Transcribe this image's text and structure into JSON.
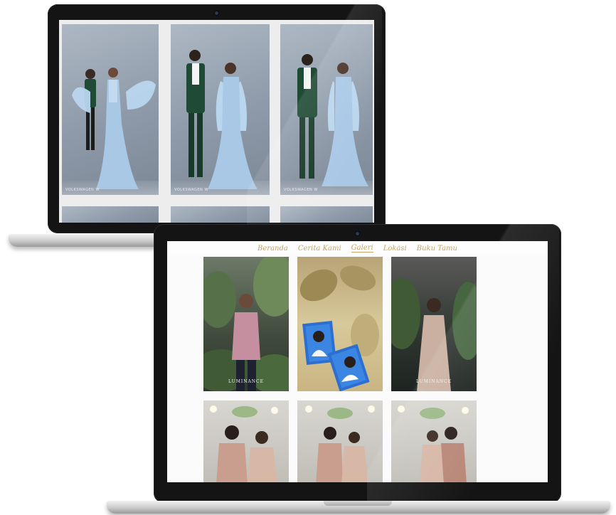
{
  "back_laptop": {
    "photos": [
      {
        "watermark": "VOLKSWAGEN W"
      },
      {
        "watermark": "VOLKSWAGEN W"
      },
      {
        "watermark": "VOLKSWAGEN W"
      }
    ]
  },
  "front_laptop": {
    "nav": {
      "items": [
        "Beranda",
        "Cerita Kami",
        "Galeri",
        "Lokasi",
        "Buku Tamu"
      ],
      "active": "Galeri"
    },
    "gallery": {
      "row1": [
        {
          "brand": "LUMINANCE"
        },
        {
          "brand": ""
        },
        {
          "brand": "LUMINANCE"
        }
      ]
    }
  },
  "colors": {
    "nav_gold": "#c4a564",
    "bezel": "#141414",
    "gown_blue": "#a9c8e6",
    "suit_green": "#1f4a35"
  }
}
